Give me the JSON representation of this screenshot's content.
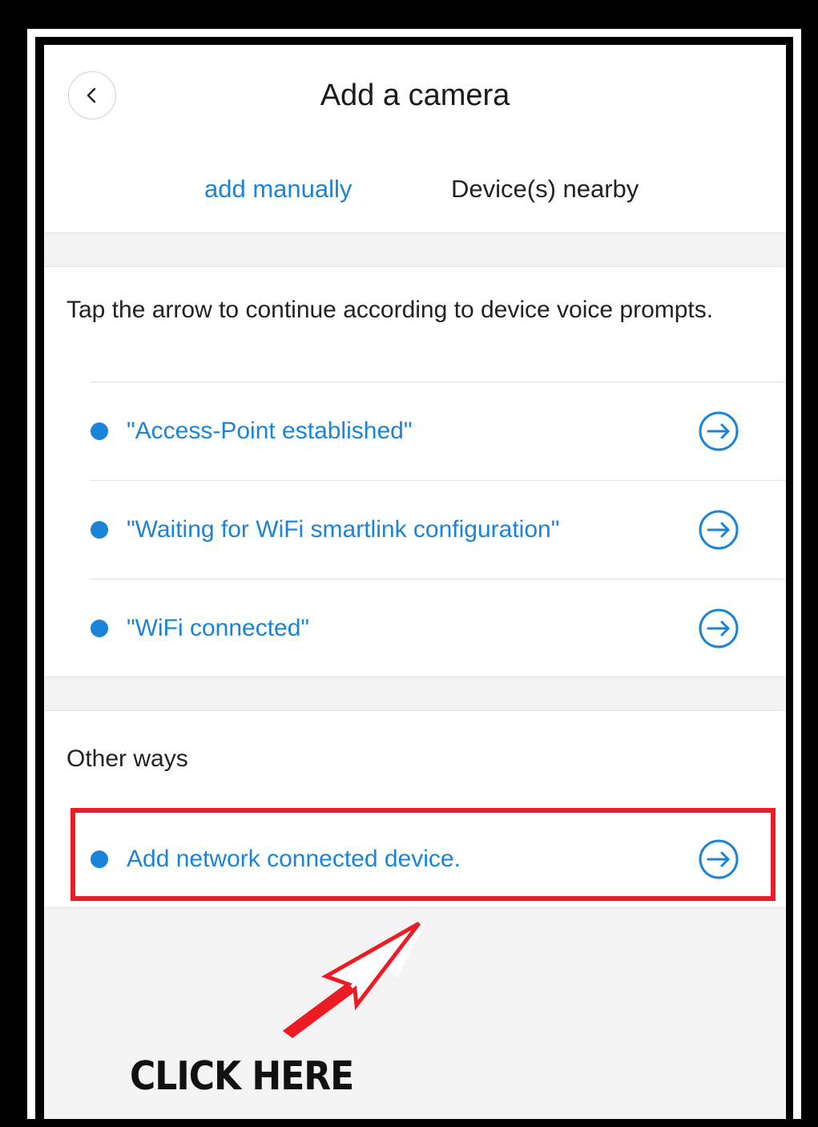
{
  "header": {
    "title": "Add a camera",
    "back_icon": "chevron-left-icon"
  },
  "tabs": [
    {
      "label": "add manually",
      "active": true
    },
    {
      "label": "Device(s) nearby",
      "active": false
    }
  ],
  "instructions": "Tap the arrow to continue according to device voice prompts.",
  "prompts": [
    {
      "label": "\"Access-Point established\""
    },
    {
      "label": "\"Waiting for WiFi smartlink configuration\""
    },
    {
      "label": "\"WiFi connected\""
    }
  ],
  "other_ways": {
    "heading": "Other ways",
    "items": [
      {
        "label": "Add network connected device."
      }
    ]
  },
  "annotation": {
    "text": "CLICK HERE"
  },
  "colors": {
    "accent": "#1a84d8",
    "highlight": "#ec1c24"
  }
}
